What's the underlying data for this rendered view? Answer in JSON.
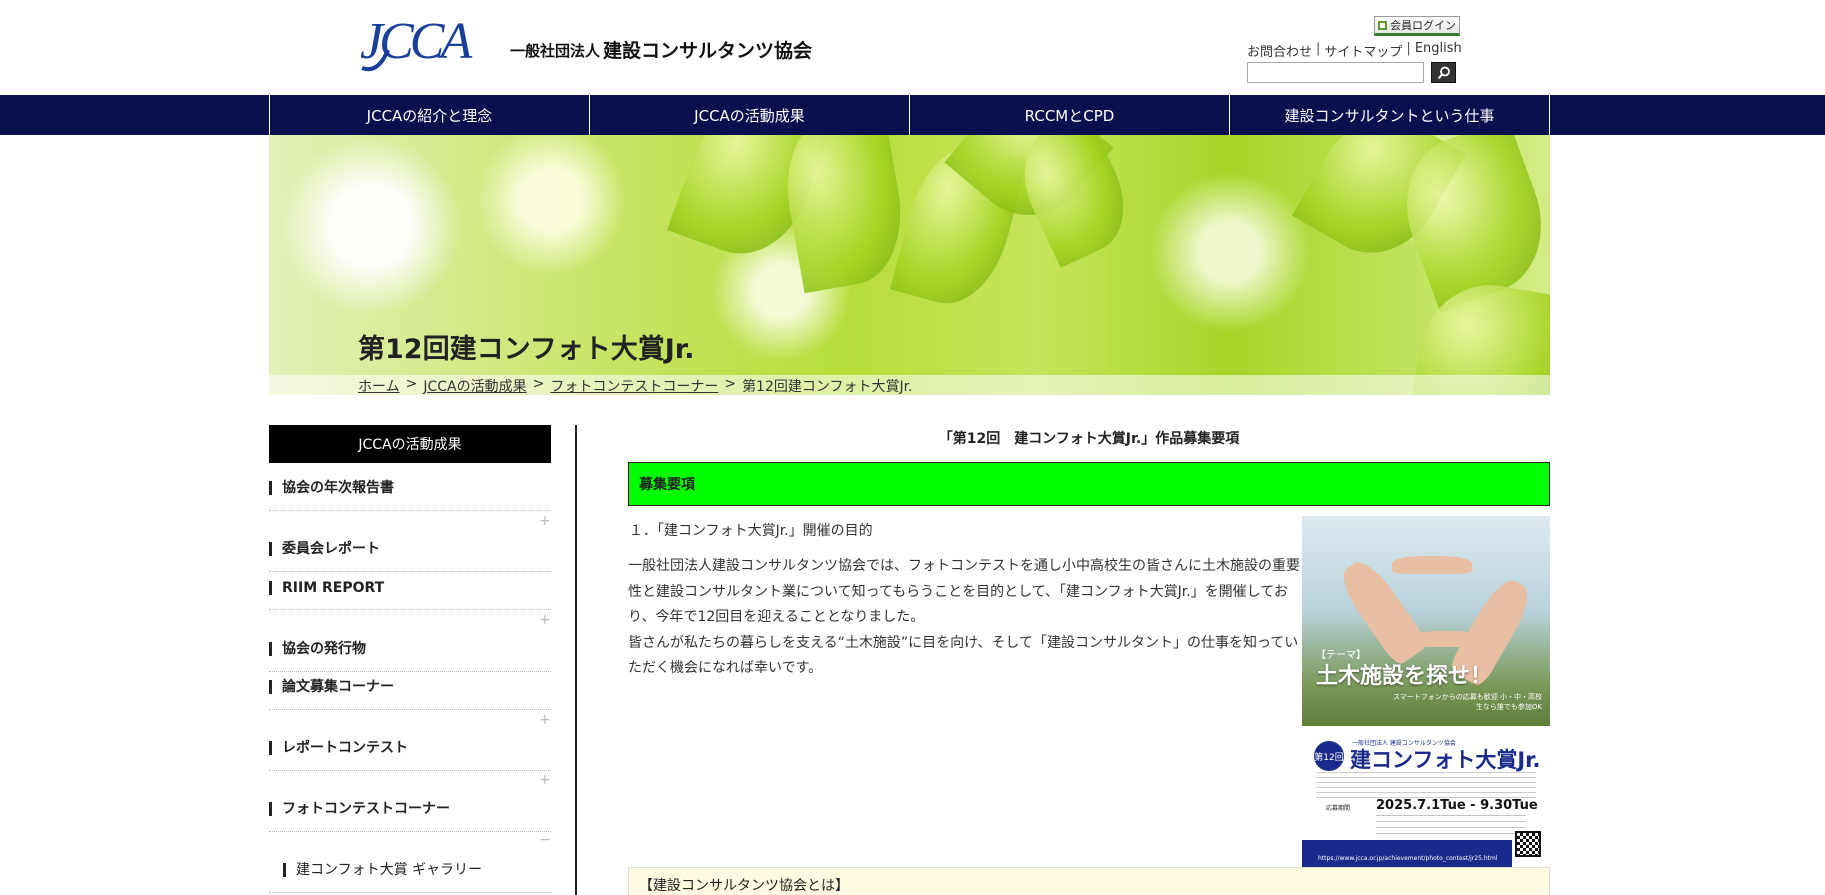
{
  "header": {
    "logo_text": "JCCA",
    "org_small": "一般社団法人",
    "org_large": "建設コンサルタンツ協会",
    "login_label": "会員ログイン",
    "util_links": [
      "お問合わせ",
      "サイトマップ",
      "English"
    ],
    "search_placeholder": ""
  },
  "nav": {
    "items": [
      "JCCAの紹介と理念",
      "JCCAの活動成果",
      "RCCMとCPD",
      "建設コンサルタントという仕事"
    ]
  },
  "banner": {
    "title": "第12回建コンフォト大賞Jr."
  },
  "breadcrumb": {
    "items": [
      "ホーム",
      "JCCAの活動成果",
      "フォトコンテストコーナー"
    ],
    "current": "第12回建コンフォト大賞Jr.",
    "separator": ">"
  },
  "sidebar": {
    "heading": "JCCAの活動成果",
    "items": [
      "協会の年次報告書",
      "委員会レポート",
      "RIIM REPORT",
      "協会の発行物",
      "論文募集コーナー",
      "レポートコンテスト",
      "フォトコンテストコーナー",
      "建コンフォト大賞 ギャラリー"
    ],
    "expand_plus": "+",
    "collapse_minus": "−"
  },
  "main": {
    "title": "「第12回　建コンフォト大賞Jr.」作品募集要項",
    "section_box": "募集要項",
    "section_head": "１．「建コンフォト大賞Jr.」開催の目的",
    "paragraph_1": "一般社団法人建設コンサルタンツ協会では、フォトコンテストを通し小中高校生の皆さんに土木施設の重要性と建設コンサルタント業について知ってもらうことを目的として、「建コンフォト大賞Jr.」を開催しており、今年で12回目を迎えることとなりました。",
    "paragraph_2": "皆さんが私たちの暮らしを支える“土木施設”に目を向け、そして「建設コンサルタント」の仕事を知っていただく機会になれば幸いです。",
    "yellow_box": "【建設コンサルタンツ協会とは】"
  },
  "poster": {
    "theme_label": "【テーマ】",
    "headline": "土木施設を探せ！",
    "sub_text": "スマートフォンからの応募も歓迎 小・中・高校生なら誰でも参加OK",
    "badge": "第12回",
    "org": "一般社団法人 建設コンサルタンツ協会",
    "name": "建コンフォト大賞Jr.",
    "date_label": "応募期間",
    "date": "2025.7.1Tue - 9.30Tue",
    "url": "https://www.jcca.or.jp/achievement/photo_contest/jr25.html"
  },
  "colors": {
    "nav_bg": "#0a0f4e",
    "section_green": "#00ff00",
    "poster_blue": "#1a2a8a"
  }
}
